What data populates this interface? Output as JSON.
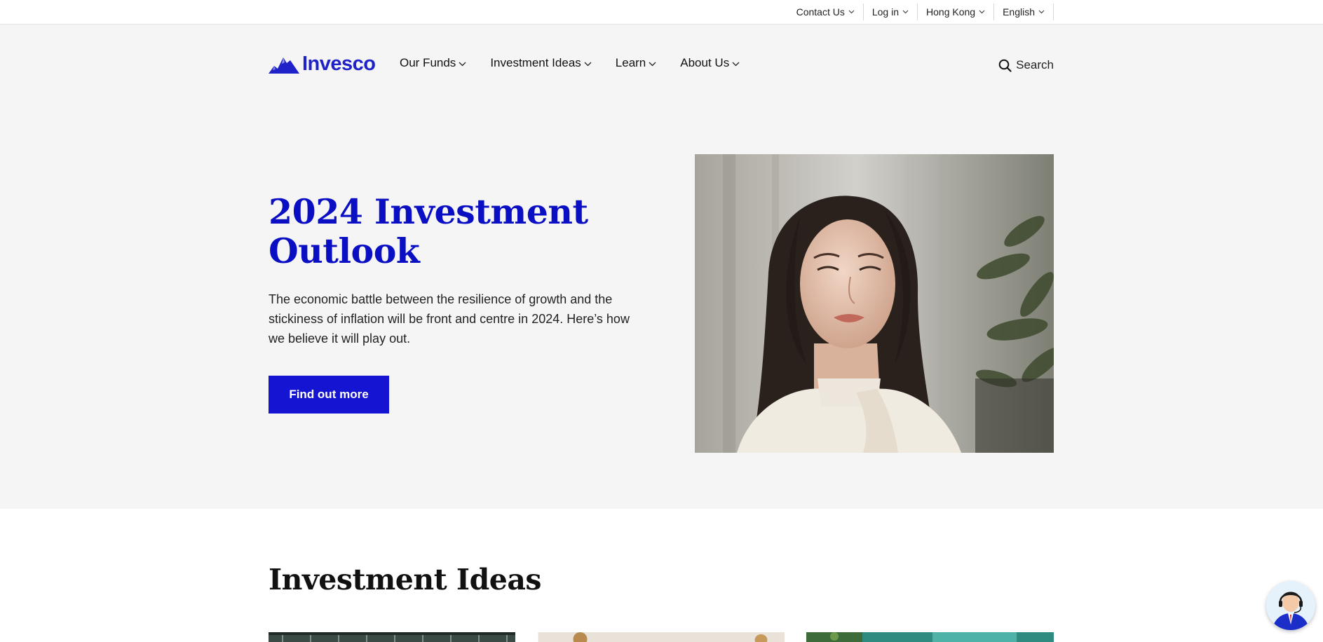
{
  "utility_nav": {
    "items": [
      {
        "label": "Contact Us"
      },
      {
        "label": "Log in"
      },
      {
        "label": "Hong Kong"
      },
      {
        "label": "English"
      }
    ]
  },
  "header": {
    "logo_text": "Invesco",
    "nav": [
      {
        "label": "Our Funds"
      },
      {
        "label": "Investment Ideas"
      },
      {
        "label": "Learn"
      },
      {
        "label": "About Us"
      }
    ],
    "search_label": "Search"
  },
  "hero": {
    "title": "2024 Investment Outlook",
    "description": "The economic battle between the resilience of growth and the stickiness of inflation will be front and centre in 2024. Here’s how we believe it will play out.",
    "cta_label": "Find out more"
  },
  "investment_ideas": {
    "title": "Investment Ideas"
  },
  "colors": {
    "brand_blue": "#1414d2",
    "title_blue": "#0b0fc4",
    "hero_background": "#f5f5f5"
  },
  "icons": {
    "chevron": "chevron-down-icon",
    "search": "search-icon",
    "logo_mark": "mountain-logo-icon",
    "chat": "chat-assistant-icon"
  }
}
